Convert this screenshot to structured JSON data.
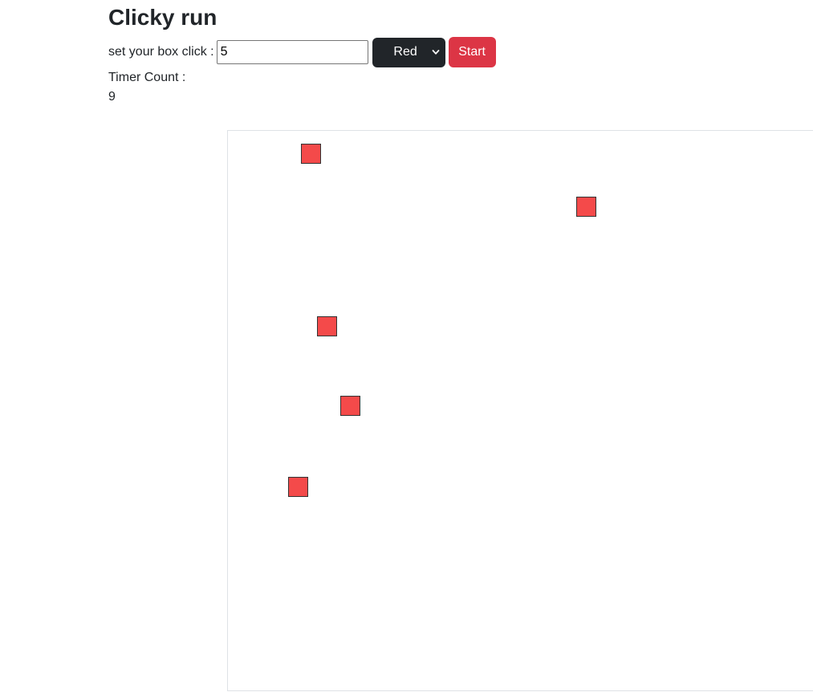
{
  "page": {
    "title": "Clicky run"
  },
  "controls": {
    "label": "set your box click :",
    "click_input_value": "5",
    "color_select": {
      "selected": "Red"
    },
    "start_label": "Start"
  },
  "timer": {
    "label": "Timer Count :",
    "value": "9"
  },
  "colors": {
    "box_fill": "#f44a4a",
    "start_button": "#dc3545",
    "select_bg": "#212529"
  },
  "play_area": {
    "box_count": 5
  }
}
